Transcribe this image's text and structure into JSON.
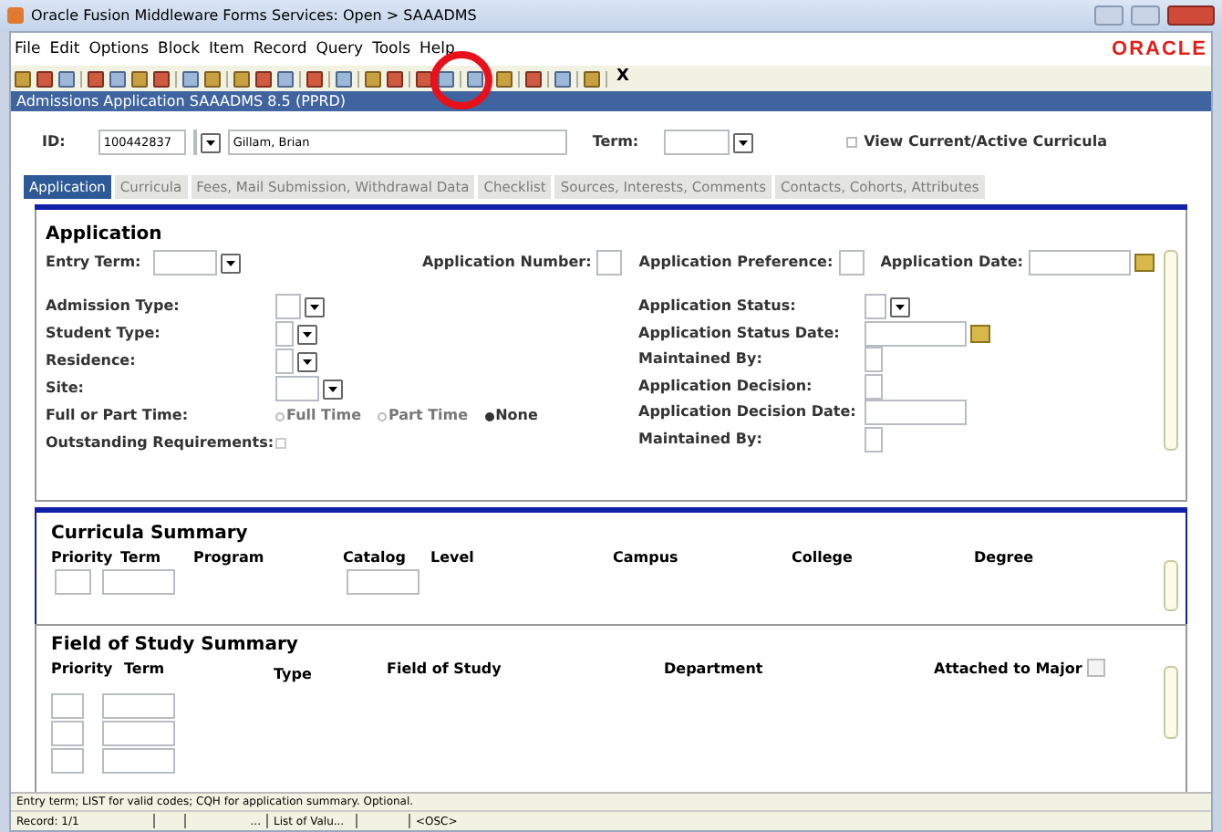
{
  "window": {
    "title": "Oracle Fusion Middleware Forms Services:  Open > SAAADMS"
  },
  "menu": [
    "File",
    "Edit",
    "Options",
    "Block",
    "Item",
    "Record",
    "Query",
    "Tools",
    "Help"
  ],
  "brand": "ORACLE",
  "toolbar": {
    "exit": "X"
  },
  "form_title": "Admissions Application  SAAADMS  8.5  (PPRD)",
  "key_block": {
    "id_label": "ID:",
    "id_value": "100442837",
    "name_value": "Gillam, Brian",
    "term_label": "Term:",
    "view_current": {
      "label": "View Current/Active Curricula",
      "checked": false
    }
  },
  "tabs": [
    {
      "label": "Application",
      "selected": true
    },
    {
      "label": "Curricula",
      "selected": false
    },
    {
      "label": "Fees, Mail Submission, Withdrawal Data",
      "selected": false
    },
    {
      "label": "Checklist",
      "selected": false
    },
    {
      "label": "Sources, Interests, Comments",
      "selected": false
    },
    {
      "label": "Contacts, Cohorts, Attributes",
      "selected": false
    }
  ],
  "application": {
    "title": "Application",
    "entry_term": "Entry Term:",
    "application_number": "Application Number:",
    "application_preference": "Application Preference:",
    "application_date": "Application Date:",
    "left_fields": [
      {
        "label": "Admission Type:",
        "kind": "lov"
      },
      {
        "label": "Student Type:",
        "kind": "lov"
      },
      {
        "label": "Residence:",
        "kind": "lov"
      },
      {
        "label": "Site:",
        "kind": "lov"
      }
    ],
    "full_or_part": {
      "label": "Full or Part Time:",
      "options": [
        {
          "label": "Full Time",
          "selected": false
        },
        {
          "label": "Part Time",
          "selected": false
        },
        {
          "label": "None",
          "selected": true
        }
      ]
    },
    "outstanding": {
      "label": "Outstanding Requirements:",
      "checked": false
    },
    "right_fields": [
      {
        "label": "Application Status:",
        "kind": "lov"
      },
      {
        "label": "Application Status Date:",
        "kind": "date"
      },
      {
        "label": "Maintained By:",
        "kind": "small"
      },
      {
        "label": "Application Decision:",
        "kind": "small"
      },
      {
        "label": "Application Decision Date:",
        "kind": "wide"
      },
      {
        "label": "Maintained By:",
        "kind": "small"
      }
    ]
  },
  "curricula_summary": {
    "title": "Curricula Summary",
    "columns": [
      "Priority",
      "Term",
      "Program",
      "Catalog",
      "Level",
      "Campus",
      "College",
      "Degree"
    ]
  },
  "field_of_study_summary": {
    "title": "Field of Study Summary",
    "columns": [
      "Priority",
      "Term",
      "Type",
      "Field of Study",
      "Department",
      "Attached to Major"
    ],
    "attached_to_major_checked": false
  },
  "status_bar": {
    "hint": "Entry term; LIST for valid codes; CQH for application summary. Optional.",
    "record": "Record: 1/1",
    "ellipsis": "...",
    "lov": "List of Valu...",
    "osc": "<OSC>"
  }
}
